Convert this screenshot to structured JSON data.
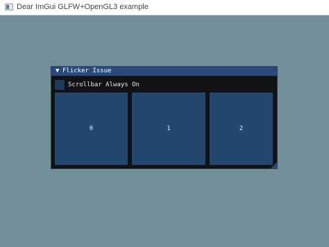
{
  "os_window": {
    "title": "Dear ImGui GLFW+OpenGL3 example",
    "icon": "app-window-icon"
  },
  "imgui_window": {
    "title": "Flicker Issue",
    "collapse_icon": "▼",
    "checkbox": {
      "label": "Scrollbar Always On",
      "checked": false
    },
    "panels": [
      {
        "label": "0"
      },
      {
        "label": "1"
      },
      {
        "label": "2"
      }
    ]
  },
  "colors": {
    "background": "#728f99",
    "window_bg": "#101215",
    "title_bg": "#294a7a",
    "panel_bg": "#24476f"
  }
}
